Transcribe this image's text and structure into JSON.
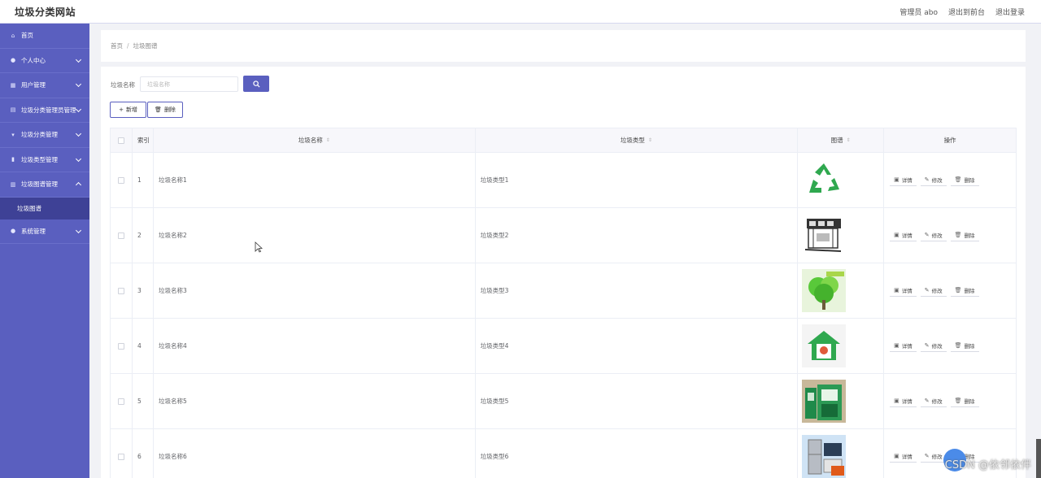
{
  "header": {
    "site_title": "垃圾分类网站",
    "user_label": "管理员 abo",
    "back_front_label": "退出到前台",
    "logout_label": "退出登录"
  },
  "sidebar": {
    "items": [
      {
        "label": "首页",
        "icon": "home-icon",
        "expandable": false
      },
      {
        "label": "个人中心",
        "icon": "user-icon",
        "expandable": true
      },
      {
        "label": "用户管理",
        "icon": "grid-icon",
        "expandable": true
      },
      {
        "label": "垃圾分类管理员管理",
        "icon": "list-icon",
        "expandable": true
      },
      {
        "label": "垃圾分类管理",
        "icon": "trophy-icon",
        "expandable": true
      },
      {
        "label": "垃圾类型管理",
        "icon": "bar-chart-icon",
        "expandable": true
      },
      {
        "label": "垃圾图谱管理",
        "icon": "table-icon",
        "expandable": true,
        "expanded": true
      },
      {
        "label": "系统管理",
        "icon": "person-icon",
        "expandable": true
      }
    ],
    "active_sub_item": "垃圾图谱"
  },
  "breadcrumb": {
    "home": "首页",
    "separator": "/",
    "current": "垃圾图谱"
  },
  "search": {
    "label": "垃圾名称",
    "placeholder": "垃圾名称",
    "icon": "search-icon"
  },
  "toolbar": {
    "add_label": "新增",
    "delete_label": "删除"
  },
  "table": {
    "headers": {
      "index": "索引",
      "name": "垃圾名称",
      "type": "垃圾类型",
      "image": "图谱",
      "ops": "操作"
    },
    "ops_labels": {
      "detail": "详情",
      "edit": "修改",
      "delete": "删除"
    },
    "rows": [
      {
        "index": "1",
        "name": "垃圾名称1",
        "type": "垃圾类型1",
        "image": "recycle-symbol"
      },
      {
        "index": "2",
        "name": "垃圾名称2",
        "type": "垃圾类型2",
        "image": "kiosk-sketch"
      },
      {
        "index": "3",
        "name": "垃圾名称3",
        "type": "垃圾类型3",
        "image": "green-tree"
      },
      {
        "index": "4",
        "name": "垃圾名称4",
        "type": "垃圾类型4",
        "image": "green-house-badge"
      },
      {
        "index": "5",
        "name": "垃圾名称5",
        "type": "垃圾类型5",
        "image": "recycle-bin-machine"
      },
      {
        "index": "6",
        "name": "垃圾名称6",
        "type": "垃圾类型6",
        "image": "appliances"
      }
    ]
  },
  "colors": {
    "primary": "#5a5fbf",
    "sidebar_active": "#3e4196",
    "green": "#2fa84f"
  },
  "watermark": "CSDN @依邻依伴"
}
